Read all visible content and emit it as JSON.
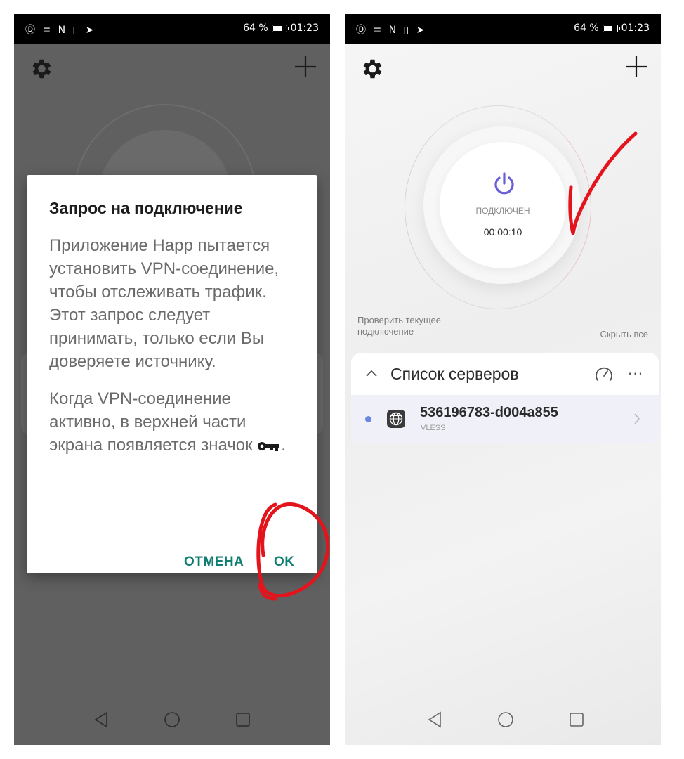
{
  "status_bar": {
    "left_icons": "Ⓓ ≡ N ▯ ➤",
    "battery_percent_label": "64 %",
    "battery_level": 0.64,
    "time": "01:23"
  },
  "left_screen": {
    "dialog": {
      "title": "Запрос на подключение",
      "paragraph1": "Приложение Happ пытается установить VPN-соединение, чтобы отслеживать трафик. Этот запрос следует принимать, только если Вы доверяете источнику.",
      "paragraph2_text": "Когда VPN-соединение активно, в верхней части экрана появляется значок",
      "paragraph2_end": ".",
      "key_icon": "key-icon",
      "cancel_label": "ОТМЕНА",
      "ok_label": "OK"
    },
    "annotation": "red-circle-around-ok"
  },
  "right_screen": {
    "connection": {
      "state_label": "ПОДКЛЮЧЕН",
      "timer": "00:00:10",
      "power_icon": "power-icon"
    },
    "check_connection_label": "Проверить текущее подключение",
    "hide_all_label": "Скрыть все",
    "server_list": {
      "title": "Список серверов",
      "more_label": "···",
      "servers": [
        {
          "name": "536196783-d004a855",
          "protocol": "VLESS",
          "selected": true
        }
      ]
    },
    "annotation": "red-check-mark"
  },
  "nav_bar": [
    "back-icon",
    "home-icon",
    "recents-icon"
  ],
  "colors": {
    "accent_teal": "#0f7f72",
    "power_purple": "#6a5fd6",
    "selected_dot": "#6d86e0",
    "annotation_red": "#e3141b"
  }
}
